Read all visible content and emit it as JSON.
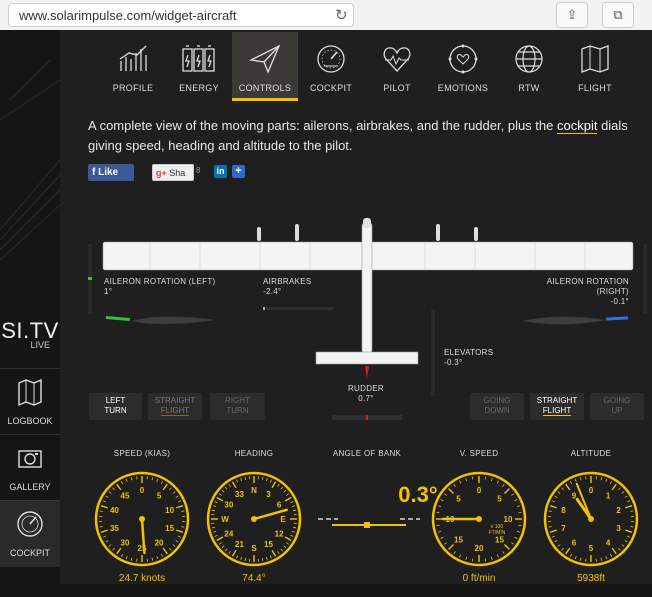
{
  "browser": {
    "url": "www.solarimpulse.com/widget-aircraft"
  },
  "sidebar": {
    "sitv": {
      "big": "SI.TV",
      "live": "LIVE"
    },
    "items": [
      {
        "label": "LOGBOOK",
        "icon": "map-icon"
      },
      {
        "label": "GALLERY",
        "icon": "camera-icon"
      },
      {
        "label": "COCKPIT",
        "icon": "gauge-icon",
        "active": true
      }
    ]
  },
  "tabs": [
    {
      "label": "PROFILE",
      "icon": "chart-icon"
    },
    {
      "label": "ENERGY",
      "icon": "battery-icon"
    },
    {
      "label": "CONTROLS",
      "icon": "paper-plane-icon",
      "active": true
    },
    {
      "label": "COCKPIT",
      "icon": "gauge-icon"
    },
    {
      "label": "PILOT",
      "icon": "heart-icon"
    },
    {
      "label": "EMOTIONS",
      "icon": "emotions-icon"
    },
    {
      "label": "RTW",
      "icon": "globe-icon"
    },
    {
      "label": "FLIGHT",
      "icon": "map-icon"
    }
  ],
  "description": {
    "before": "A complete view of the moving parts: ailerons, airbrakes, and the rudder, plus the ",
    "link": "cockpit",
    "after": " dials giving speed, heading and altitude to the pilot."
  },
  "social": {
    "facebook": "Like",
    "gplus": "Sha",
    "gplus_count": "8",
    "linkedin": "in",
    "plus": "+"
  },
  "controls": {
    "aileron_left": {
      "label": "AILERON ROTATION (LEFT)",
      "value": "1°"
    },
    "airbrakes": {
      "label": "AIRBRAKES",
      "value": "-2.4°"
    },
    "aileron_right": {
      "label": "AILERON ROTATION (RIGHT)",
      "value": "-0.1°"
    },
    "elevators": {
      "label": "ELEVATORS",
      "value": "-0.3°"
    },
    "rudder": {
      "label": "RUDDER",
      "value": "0.7°"
    }
  },
  "buttons": {
    "left_turn": [
      "LEFT",
      "TURN"
    ],
    "straight_flight_1": [
      "STRAIGHT",
      "FLIGHT"
    ],
    "right_turn": [
      "RIGHT",
      "TURN"
    ],
    "going_down": [
      "GOING",
      "DOWN"
    ],
    "straight_flight_2": [
      "STRAIGHT",
      "FLIGHT"
    ],
    "going_up": [
      "GOING",
      "UP"
    ]
  },
  "gauges": {
    "speed": {
      "title": "SPEED (KIAS)",
      "value": "24.7 knots",
      "ticks": [
        "0",
        "5",
        "10",
        "15",
        "20",
        "25",
        "30",
        "35",
        "40",
        "45"
      ]
    },
    "heading": {
      "title": "HEADING",
      "value": "74.4°",
      "ticks": [
        "N",
        "3",
        "6",
        "E",
        "12",
        "15",
        "S",
        "21",
        "24",
        "W",
        "30",
        "33"
      ]
    },
    "bank": {
      "title": "ANGLE OF BANK",
      "value": "0.3°"
    },
    "vspeed": {
      "title": "V. SPEED",
      "value": "0 ft/min",
      "ticks": [
        "0",
        "5",
        "10",
        "15",
        "20",
        "15",
        "10",
        "5"
      ],
      "unit1": "x 100",
      "unit2": "FT/MIN"
    },
    "altitude": {
      "title": "ALTITUDE",
      "value": "5938ft",
      "ticks": [
        "0",
        "1",
        "2",
        "3",
        "4",
        "5",
        "6",
        "7",
        "8",
        "9"
      ]
    }
  },
  "colors": {
    "accent": "#f2c100",
    "aileron_left": "#2cc43a",
    "aileron_right": "#2f6fe0",
    "rudder": "#e01a1a"
  }
}
